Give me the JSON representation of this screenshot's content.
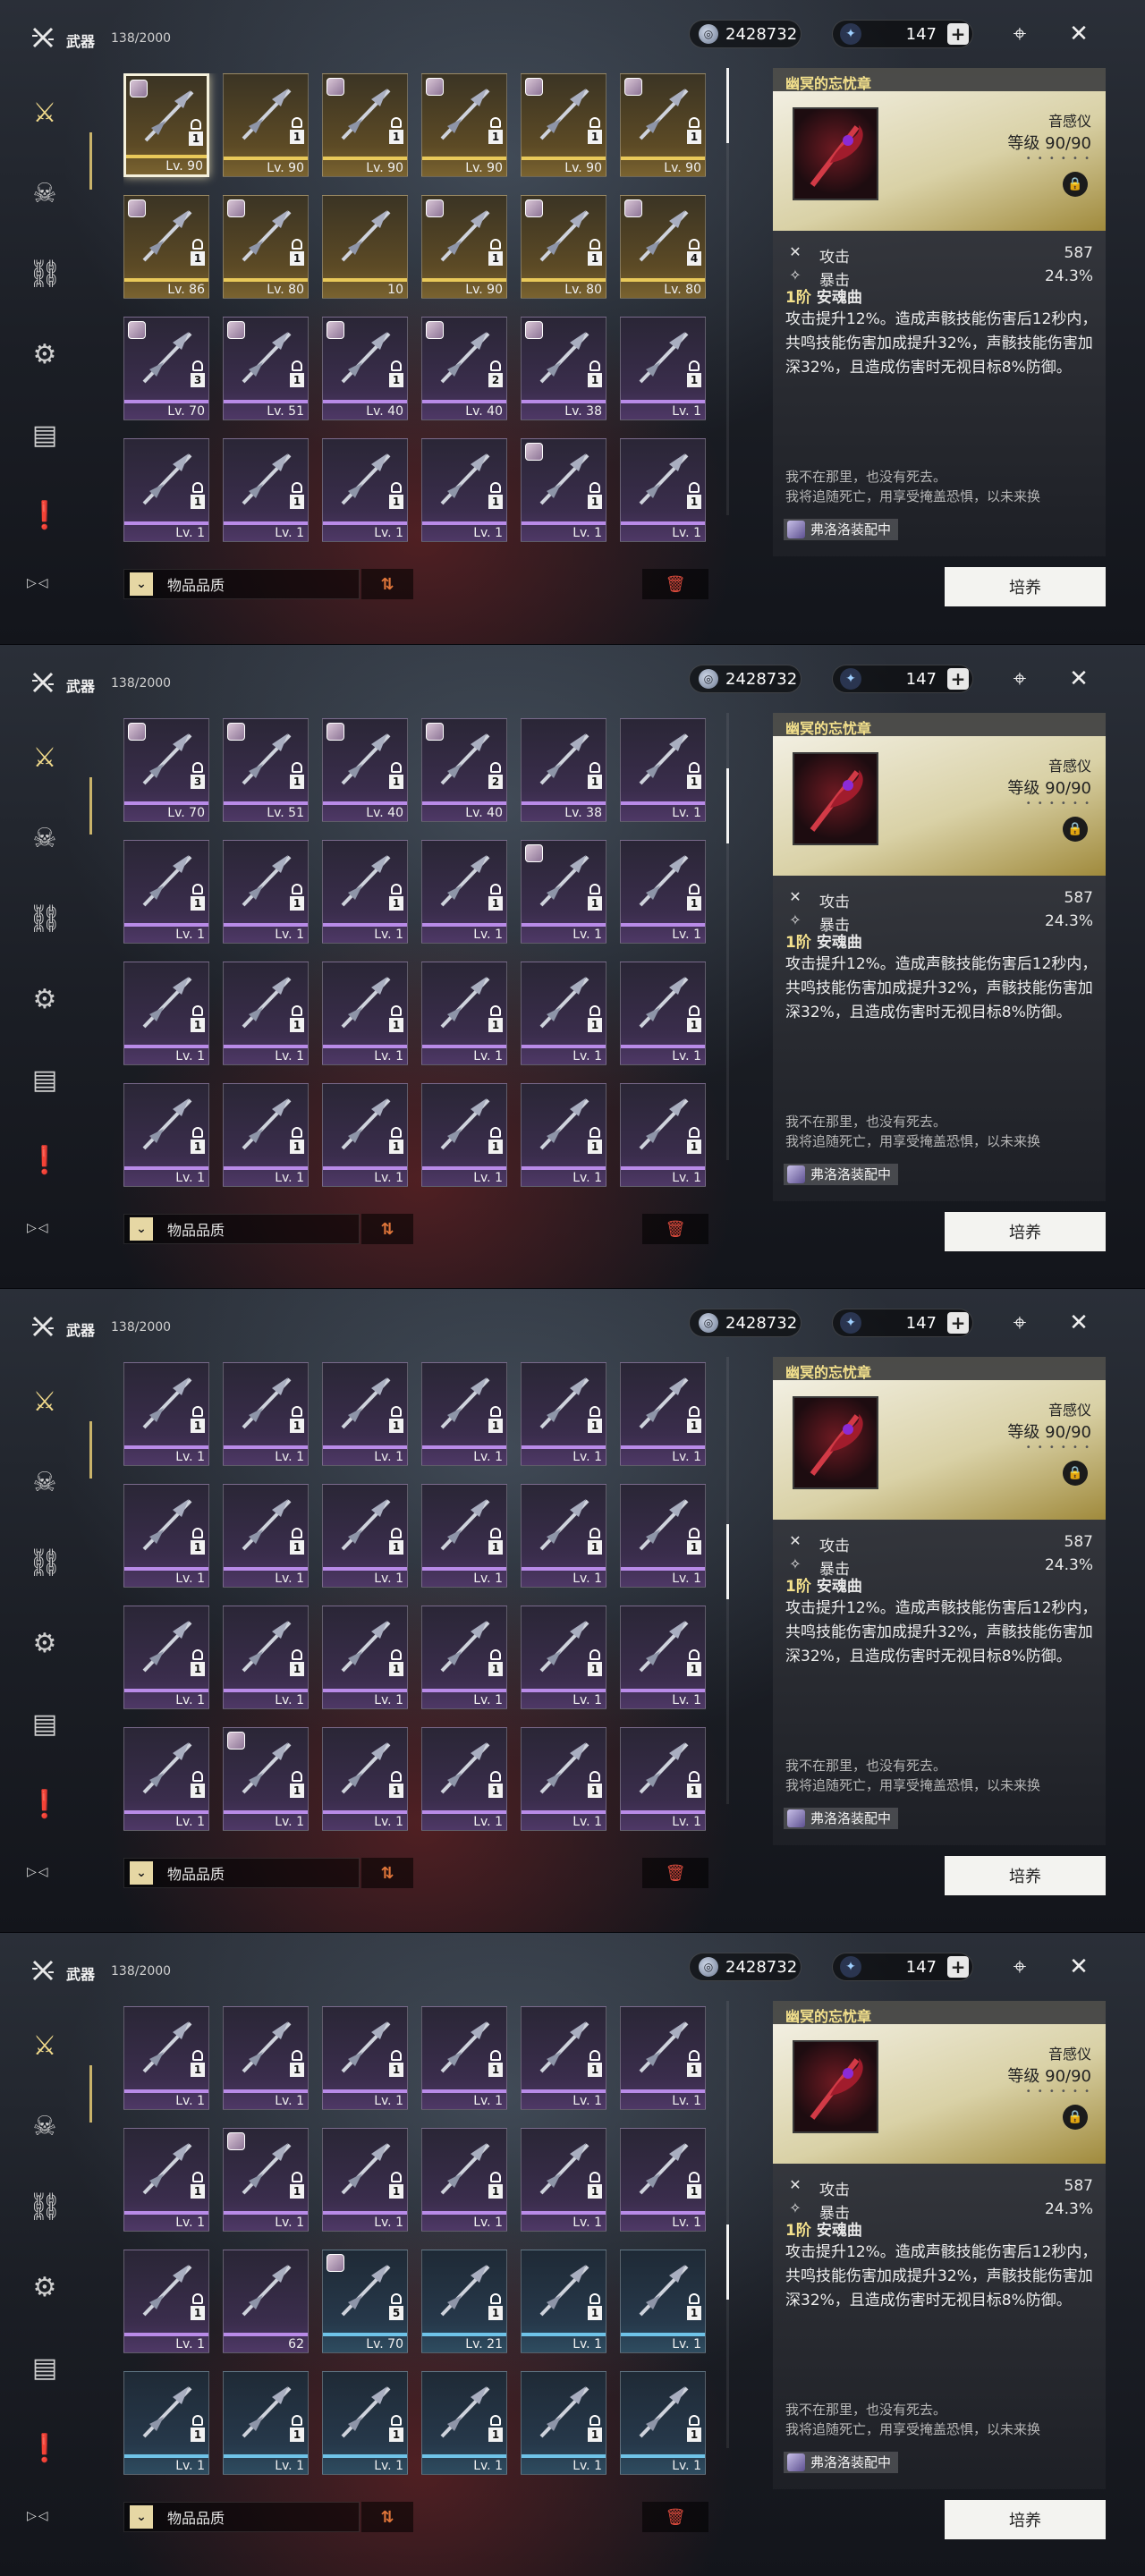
{
  "topbar": {
    "title": "武器",
    "count": "138/2000",
    "shell_credit": "2428732",
    "astrite": "147",
    "plus": "+"
  },
  "filter": {
    "label": "物品品质"
  },
  "detail": {
    "name": "幽冥的忘忧章",
    "type": "音感仪",
    "level_label": "等级",
    "level": "90/90",
    "stars": "• • • • • •",
    "stats": [
      {
        "icon": "atk-icon",
        "name": "攻击",
        "value": "587"
      },
      {
        "icon": "crit-icon",
        "name": "暴击",
        "value": "24.3%"
      }
    ],
    "passive_rank": "1阶",
    "passive_name": "安魂曲",
    "passive_text": "攻击提升12%。造成声骸技能伤害后12秒内，共鸣技能伤害加成提升32%，声骸技能伤害加深32%，且造成伤害时无视目标8%防御。",
    "flavor_1": "我不在那里，也没有死去。",
    "flavor_2": "我将追随死亡，用享受掩盖恐惧，以未来换",
    "equipped": "弗洛洛装配中",
    "develop_label": "培养"
  },
  "panels": [
    {
      "scroll_offset": 0,
      "rows": [
        [
          {
            "rarity": "r5",
            "qty": "1",
            "lv": "Lv. 90",
            "lock": true,
            "avatar": true,
            "selected": true
          },
          {
            "rarity": "r5",
            "qty": "1",
            "lv": "Lv. 90",
            "lock": true
          },
          {
            "rarity": "r5",
            "qty": "1",
            "lv": "Lv. 90",
            "lock": true,
            "avatar": true
          },
          {
            "rarity": "r5",
            "qty": "1",
            "lv": "Lv. 90",
            "lock": true,
            "avatar": true
          },
          {
            "rarity": "r5",
            "qty": "1",
            "lv": "Lv. 90",
            "lock": true,
            "avatar": true
          },
          {
            "rarity": "r5",
            "qty": "1",
            "lv": "Lv. 90",
            "lock": true,
            "avatar": true
          }
        ],
        [
          {
            "rarity": "r5",
            "qty": "1",
            "lv": "Lv. 86",
            "lock": true,
            "avatar": true
          },
          {
            "rarity": "r5",
            "qty": "1",
            "lv": "Lv. 80",
            "lock": true,
            "avatar": true
          },
          {
            "rarity": "r5",
            "qty": "",
            "lv": "10",
            "lock": false
          },
          {
            "rarity": "r5",
            "qty": "1",
            "lv": "Lv. 90",
            "lock": true,
            "avatar": true
          },
          {
            "rarity": "r5",
            "qty": "1",
            "lv": "Lv. 80",
            "lock": true,
            "avatar": true
          },
          {
            "rarity": "r5",
            "qty": "4",
            "lv": "Lv. 80",
            "lock": true,
            "avatar": true
          }
        ],
        [
          {
            "rarity": "r4",
            "qty": "3",
            "lv": "Lv. 70",
            "lock": true,
            "avatar": true
          },
          {
            "rarity": "r4",
            "qty": "1",
            "lv": "Lv. 51",
            "lock": true,
            "avatar": true
          },
          {
            "rarity": "r4",
            "qty": "1",
            "lv": "Lv. 40",
            "lock": true,
            "avatar": true
          },
          {
            "rarity": "r4",
            "qty": "2",
            "lv": "Lv. 40",
            "lock": true,
            "avatar": true
          },
          {
            "rarity": "r4",
            "qty": "1",
            "lv": "Lv. 38",
            "lock": true,
            "avatar": true
          },
          {
            "rarity": "r4",
            "qty": "1",
            "lv": "Lv. 1",
            "lock": true
          }
        ],
        [
          {
            "rarity": "r4",
            "qty": "1",
            "lv": "Lv. 1",
            "lock": true
          },
          {
            "rarity": "r4",
            "qty": "1",
            "lv": "Lv. 1",
            "lock": true
          },
          {
            "rarity": "r4",
            "qty": "1",
            "lv": "Lv. 1",
            "lock": true
          },
          {
            "rarity": "r4",
            "qty": "1",
            "lv": "Lv. 1",
            "lock": true
          },
          {
            "rarity": "r4",
            "qty": "1",
            "lv": "Lv. 1",
            "lock": true,
            "avatar": true
          },
          {
            "rarity": "r4",
            "qty": "1",
            "lv": "Lv. 1",
            "lock": true
          }
        ]
      ]
    },
    {
      "scroll_offset": 0.15,
      "rows": [
        [
          {
            "rarity": "r4",
            "qty": "3",
            "lv": "Lv. 70",
            "lock": true,
            "avatar": true
          },
          {
            "rarity": "r4",
            "qty": "1",
            "lv": "Lv. 51",
            "lock": true,
            "avatar": true
          },
          {
            "rarity": "r4",
            "qty": "1",
            "lv": "Lv. 40",
            "lock": true,
            "avatar": true
          },
          {
            "rarity": "r4",
            "qty": "2",
            "lv": "Lv. 40",
            "lock": true,
            "avatar": true
          },
          {
            "rarity": "r4",
            "qty": "1",
            "lv": "Lv. 38",
            "lock": true
          },
          {
            "rarity": "r4",
            "qty": "1",
            "lv": "Lv. 1",
            "lock": true
          }
        ],
        [
          {
            "rarity": "r4",
            "qty": "1",
            "lv": "Lv. 1",
            "lock": true
          },
          {
            "rarity": "r4",
            "qty": "1",
            "lv": "Lv. 1",
            "lock": true
          },
          {
            "rarity": "r4",
            "qty": "1",
            "lv": "Lv. 1",
            "lock": true
          },
          {
            "rarity": "r4",
            "qty": "1",
            "lv": "Lv. 1",
            "lock": true
          },
          {
            "rarity": "r4",
            "qty": "1",
            "lv": "Lv. 1",
            "lock": true,
            "avatar": true
          },
          {
            "rarity": "r4",
            "qty": "1",
            "lv": "Lv. 1",
            "lock": true
          }
        ],
        [
          {
            "rarity": "r4",
            "qty": "1",
            "lv": "Lv. 1",
            "lock": true
          },
          {
            "rarity": "r4",
            "qty": "1",
            "lv": "Lv. 1",
            "lock": true
          },
          {
            "rarity": "r4",
            "qty": "1",
            "lv": "Lv. 1",
            "lock": true
          },
          {
            "rarity": "r4",
            "qty": "1",
            "lv": "Lv. 1",
            "lock": true
          },
          {
            "rarity": "r4",
            "qty": "1",
            "lv": "Lv. 1",
            "lock": true
          },
          {
            "rarity": "r4",
            "qty": "1",
            "lv": "Lv. 1",
            "lock": true
          }
        ],
        [
          {
            "rarity": "r4",
            "qty": "1",
            "lv": "Lv. 1",
            "lock": true
          },
          {
            "rarity": "r4",
            "qty": "1",
            "lv": "Lv. 1",
            "lock": true
          },
          {
            "rarity": "r4",
            "qty": "1",
            "lv": "Lv. 1",
            "lock": true
          },
          {
            "rarity": "r4",
            "qty": "1",
            "lv": "Lv. 1",
            "lock": true
          },
          {
            "rarity": "r4",
            "qty": "1",
            "lv": "Lv. 1",
            "lock": true
          },
          {
            "rarity": "r4",
            "qty": "1",
            "lv": "Lv. 1",
            "lock": true
          }
        ]
      ]
    },
    {
      "scroll_offset": 0.45,
      "rows": [
        [
          {
            "rarity": "r4",
            "qty": "1",
            "lv": "Lv. 1",
            "lock": true
          },
          {
            "rarity": "r4",
            "qty": "1",
            "lv": "Lv. 1",
            "lock": true
          },
          {
            "rarity": "r4",
            "qty": "1",
            "lv": "Lv. 1",
            "lock": true
          },
          {
            "rarity": "r4",
            "qty": "1",
            "lv": "Lv. 1",
            "lock": true
          },
          {
            "rarity": "r4",
            "qty": "1",
            "lv": "Lv. 1",
            "lock": true
          },
          {
            "rarity": "r4",
            "qty": "1",
            "lv": "Lv. 1",
            "lock": true
          }
        ],
        [
          {
            "rarity": "r4",
            "qty": "1",
            "lv": "Lv. 1",
            "lock": true
          },
          {
            "rarity": "r4",
            "qty": "1",
            "lv": "Lv. 1",
            "lock": true
          },
          {
            "rarity": "r4",
            "qty": "1",
            "lv": "Lv. 1",
            "lock": true
          },
          {
            "rarity": "r4",
            "qty": "1",
            "lv": "Lv. 1",
            "lock": true
          },
          {
            "rarity": "r4",
            "qty": "1",
            "lv": "Lv. 1",
            "lock": true
          },
          {
            "rarity": "r4",
            "qty": "1",
            "lv": "Lv. 1",
            "lock": true
          }
        ],
        [
          {
            "rarity": "r4",
            "qty": "1",
            "lv": "Lv. 1",
            "lock": true
          },
          {
            "rarity": "r4",
            "qty": "1",
            "lv": "Lv. 1",
            "lock": true
          },
          {
            "rarity": "r4",
            "qty": "1",
            "lv": "Lv. 1",
            "lock": true
          },
          {
            "rarity": "r4",
            "qty": "1",
            "lv": "Lv. 1",
            "lock": true
          },
          {
            "rarity": "r4",
            "qty": "1",
            "lv": "Lv. 1",
            "lock": true
          },
          {
            "rarity": "r4",
            "qty": "1",
            "lv": "Lv. 1",
            "lock": true
          }
        ],
        [
          {
            "rarity": "r4",
            "qty": "1",
            "lv": "Lv. 1",
            "lock": true
          },
          {
            "rarity": "r4",
            "qty": "1",
            "lv": "Lv. 1",
            "lock": true,
            "avatar": true
          },
          {
            "rarity": "r4",
            "qty": "1",
            "lv": "Lv. 1",
            "lock": true
          },
          {
            "rarity": "r4",
            "qty": "1",
            "lv": "Lv. 1",
            "lock": true
          },
          {
            "rarity": "r4",
            "qty": "1",
            "lv": "Lv. 1",
            "lock": true
          },
          {
            "rarity": "r4",
            "qty": "1",
            "lv": "Lv. 1",
            "lock": true
          }
        ]
      ]
    },
    {
      "scroll_offset": 0.6,
      "rows": [
        [
          {
            "rarity": "r4",
            "qty": "1",
            "lv": "Lv. 1",
            "lock": true
          },
          {
            "rarity": "r4",
            "qty": "1",
            "lv": "Lv. 1",
            "lock": true
          },
          {
            "rarity": "r4",
            "qty": "1",
            "lv": "Lv. 1",
            "lock": true
          },
          {
            "rarity": "r4",
            "qty": "1",
            "lv": "Lv. 1",
            "lock": true
          },
          {
            "rarity": "r4",
            "qty": "1",
            "lv": "Lv. 1",
            "lock": true
          },
          {
            "rarity": "r4",
            "qty": "1",
            "lv": "Lv. 1",
            "lock": true
          }
        ],
        [
          {
            "rarity": "r4",
            "qty": "1",
            "lv": "Lv. 1",
            "lock": true
          },
          {
            "rarity": "r4",
            "qty": "1",
            "lv": "Lv. 1",
            "lock": true,
            "avatar": true
          },
          {
            "rarity": "r4",
            "qty": "1",
            "lv": "Lv. 1",
            "lock": true
          },
          {
            "rarity": "r4",
            "qty": "1",
            "lv": "Lv. 1",
            "lock": true
          },
          {
            "rarity": "r4",
            "qty": "1",
            "lv": "Lv. 1",
            "lock": true
          },
          {
            "rarity": "r4",
            "qty": "1",
            "lv": "Lv. 1",
            "lock": true
          }
        ],
        [
          {
            "rarity": "r4",
            "qty": "1",
            "lv": "Lv. 1",
            "lock": true
          },
          {
            "rarity": "r4",
            "qty": "",
            "lv": "62",
            "lock": false
          },
          {
            "rarity": "r3",
            "qty": "5",
            "lv": "Lv. 70",
            "lock": true,
            "avatar": true
          },
          {
            "rarity": "r3",
            "qty": "1",
            "lv": "Lv. 21",
            "lock": true
          },
          {
            "rarity": "r3",
            "qty": "1",
            "lv": "Lv. 1",
            "lock": true
          },
          {
            "rarity": "r3",
            "qty": "1",
            "lv": "Lv. 1",
            "lock": true
          }
        ],
        [
          {
            "rarity": "r3",
            "qty": "1",
            "lv": "Lv. 1",
            "lock": true
          },
          {
            "rarity": "r3",
            "qty": "1",
            "lv": "Lv. 1",
            "lock": true
          },
          {
            "rarity": "r3",
            "qty": "1",
            "lv": "Lv. 1",
            "lock": true
          },
          {
            "rarity": "r3",
            "qty": "1",
            "lv": "Lv. 1",
            "lock": true
          },
          {
            "rarity": "r3",
            "qty": "1",
            "lv": "Lv. 1",
            "lock": true
          },
          {
            "rarity": "r3",
            "qty": "1",
            "lv": "Lv. 1",
            "lock": true
          }
        ]
      ]
    }
  ],
  "colors": {
    "accent": "#f3e08c",
    "r5": "#e9c95a",
    "r4": "#b98be8",
    "r3": "#6fc3e8"
  }
}
